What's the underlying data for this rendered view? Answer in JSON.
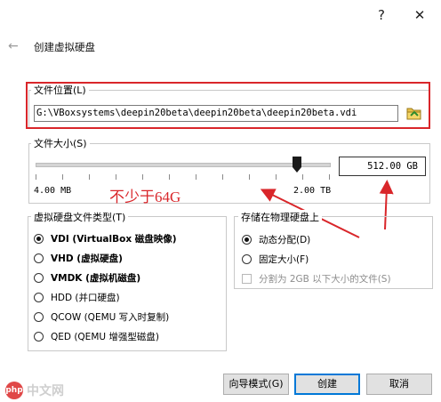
{
  "titlebar": {
    "help": "?",
    "close": "✕"
  },
  "dialog": {
    "back": "←",
    "title": "创建虚拟硬盘"
  },
  "file_location": {
    "label": "文件位置(L)",
    "path": "G:\\VBoxsystems\\deepin20beta\\deepin20beta\\deepin20beta.vdi"
  },
  "file_size": {
    "label": "文件大小(S)",
    "value": "512.00 GB",
    "min_label": "4.00 MB",
    "max_label": "2.00 TB",
    "slider_position": 0.89
  },
  "annotation": {
    "text": "不少于64G",
    "color": "#d9262a"
  },
  "disk_type": {
    "label": "虚拟硬盘文件类型(T)",
    "options": [
      {
        "label": "VDI (VirtualBox 磁盘映像)",
        "checked": true,
        "bold": true
      },
      {
        "label": "VHD (虚拟硬盘)",
        "checked": false,
        "bold": true
      },
      {
        "label": "VMDK (虚拟机磁盘)",
        "checked": false,
        "bold": true
      },
      {
        "label": "HDD (并口硬盘)",
        "checked": false,
        "bold": false
      },
      {
        "label": "QCOW (QEMU 写入时复制)",
        "checked": false,
        "bold": false
      },
      {
        "label": "QED (QEMU 增强型磁盘)",
        "checked": false,
        "bold": false
      }
    ]
  },
  "storage": {
    "label": "存储在物理硬盘上",
    "dynamic": "动态分配(D)",
    "fixed": "固定大小(F)",
    "split": "分割为 2GB 以下大小的文件(S)"
  },
  "buttons": {
    "guided": "向导模式(G)",
    "create": "创建",
    "cancel": "取消"
  },
  "watermark": {
    "logo": "php",
    "text": "中文网"
  }
}
